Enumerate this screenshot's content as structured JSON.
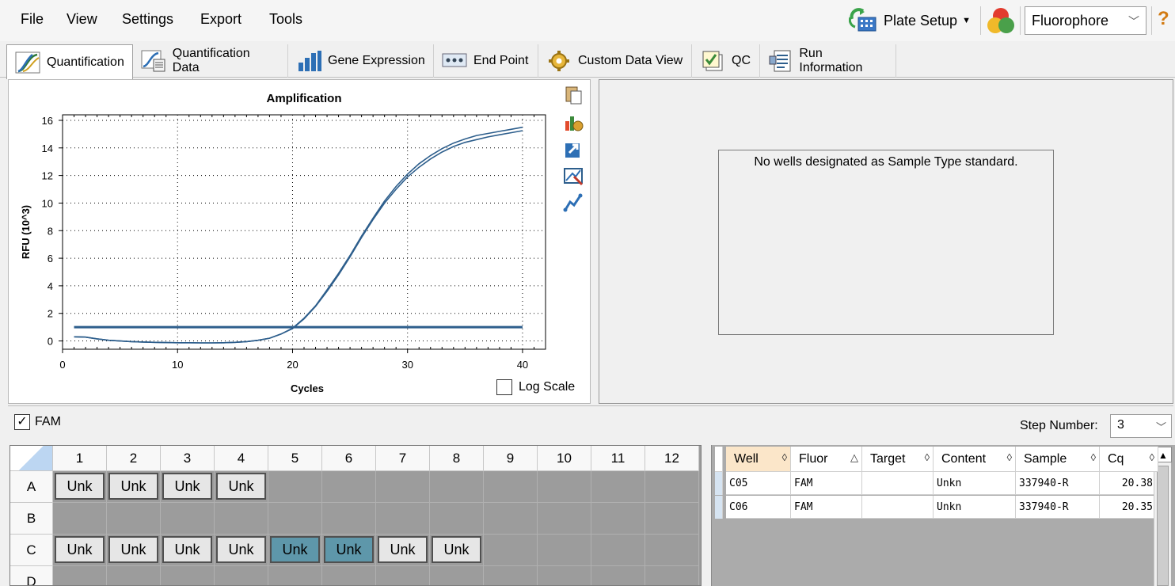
{
  "menu": [
    "File",
    "View",
    "Settings",
    "Export",
    "Tools"
  ],
  "toolbar": {
    "plate_setup_label": "Plate Setup",
    "fluorophore_value": "Fluorophore",
    "help_label": "?"
  },
  "tabs": [
    {
      "label": "Quantification",
      "icon": "amplification-tab-icon",
      "active": true
    },
    {
      "label": "Quantification Data",
      "icon": "quant-data-tab-icon"
    },
    {
      "label": "Gene Expression",
      "icon": "bar-chart-tab-icon"
    },
    {
      "label": "End Point",
      "icon": "dots-tab-icon"
    },
    {
      "label": "Custom Data View",
      "icon": "gear-tab-icon"
    },
    {
      "label": "QC",
      "icon": "checklist-tab-icon"
    },
    {
      "label": "Run Information",
      "icon": "document-tab-icon"
    }
  ],
  "chart_data": {
    "type": "line",
    "title": "Amplification",
    "xlabel": "Cycles",
    "ylabel": "RFU (10^3)",
    "xlim": [
      0,
      42
    ],
    "ylim": [
      -0.6,
      16.4
    ],
    "xticks": [
      "0",
      "10",
      "20",
      "30",
      "40"
    ],
    "yticks": [
      "0",
      "2",
      "4",
      "6",
      "8",
      "10",
      "12",
      "14",
      "16"
    ],
    "threshold": 1.0,
    "grid": "dotted",
    "series": [
      {
        "x": [
          1,
          2,
          3,
          4,
          5,
          6,
          7,
          8,
          9,
          10,
          11,
          12,
          13,
          14,
          15,
          16,
          17,
          18,
          19,
          20,
          21,
          22,
          23,
          24,
          25,
          26,
          27,
          28,
          29,
          30,
          31,
          32,
          33,
          34,
          35,
          36,
          37,
          38,
          39,
          40
        ],
        "y": [
          0.3,
          0.28,
          0.15,
          0.05,
          0.0,
          -0.05,
          -0.08,
          -0.1,
          -0.12,
          -0.13,
          -0.13,
          -0.14,
          -0.14,
          -0.13,
          -0.1,
          -0.05,
          0.05,
          0.2,
          0.5,
          0.9,
          1.6,
          2.5,
          3.6,
          4.8,
          6.1,
          7.5,
          8.8,
          10.0,
          11.0,
          11.9,
          12.6,
          13.2,
          13.7,
          14.1,
          14.4,
          14.6,
          14.8,
          14.95,
          15.1,
          15.25
        ]
      },
      {
        "x": [
          1,
          2,
          3,
          4,
          5,
          6,
          7,
          8,
          9,
          10,
          11,
          12,
          13,
          14,
          15,
          16,
          17,
          18,
          19,
          20,
          21,
          22,
          23,
          24,
          25,
          26,
          27,
          28,
          29,
          30,
          31,
          32,
          33,
          34,
          35,
          36,
          37,
          38,
          39,
          40
        ],
        "y": [
          0.3,
          0.28,
          0.15,
          0.05,
          0.0,
          -0.05,
          -0.08,
          -0.1,
          -0.12,
          -0.13,
          -0.13,
          -0.14,
          -0.14,
          -0.13,
          -0.1,
          -0.05,
          0.05,
          0.2,
          0.5,
          0.92,
          1.65,
          2.55,
          3.7,
          4.9,
          6.2,
          7.6,
          8.9,
          10.15,
          11.2,
          12.1,
          12.85,
          13.45,
          13.95,
          14.35,
          14.65,
          14.9,
          15.05,
          15.2,
          15.35,
          15.5
        ]
      }
    ],
    "line_color": "#2d5e8c"
  },
  "chart_tools": [
    "copy-icon",
    "chart-settings-icon",
    "export-icon",
    "zoom-icon",
    "trace-icon"
  ],
  "log_scale_label": "Log Scale",
  "standard_message": "No wells designated as Sample Type standard.",
  "fam_label": "FAM",
  "step": {
    "label": "Step Number:",
    "value": "3"
  },
  "plate": {
    "columns": [
      "1",
      "2",
      "3",
      "4",
      "5",
      "6",
      "7",
      "8",
      "9",
      "10",
      "11",
      "12"
    ],
    "rows": [
      {
        "label": "A",
        "wells": [
          "Unk",
          "Unk",
          "Unk",
          "Unk",
          "",
          "",
          "",
          "",
          "",
          "",
          "",
          ""
        ],
        "selected": []
      },
      {
        "label": "B",
        "wells": [
          "",
          "",
          "",
          "",
          "",
          "",
          "",
          "",
          "",
          "",
          "",
          ""
        ],
        "selected": []
      },
      {
        "label": "C",
        "wells": [
          "Unk",
          "Unk",
          "Unk",
          "Unk",
          "Unk",
          "Unk",
          "Unk",
          "Unk",
          "",
          "",
          "",
          ""
        ],
        "selected": [
          4,
          5
        ]
      },
      {
        "label": "D",
        "wells": [
          "",
          "",
          "",
          "",
          "",
          "",
          "",
          "",
          "",
          "",
          "",
          ""
        ],
        "selected": []
      }
    ]
  },
  "results": {
    "headers": [
      "Well",
      "Fluor",
      "Target",
      "Content",
      "Sample",
      "Cq"
    ],
    "sort_column": "Well",
    "rows": [
      [
        "C05",
        "FAM",
        "",
        "Unkn",
        "337940-R",
        "20.38"
      ],
      [
        "C06",
        "FAM",
        "",
        "Unkn",
        "337940-R",
        "20.35"
      ]
    ]
  }
}
